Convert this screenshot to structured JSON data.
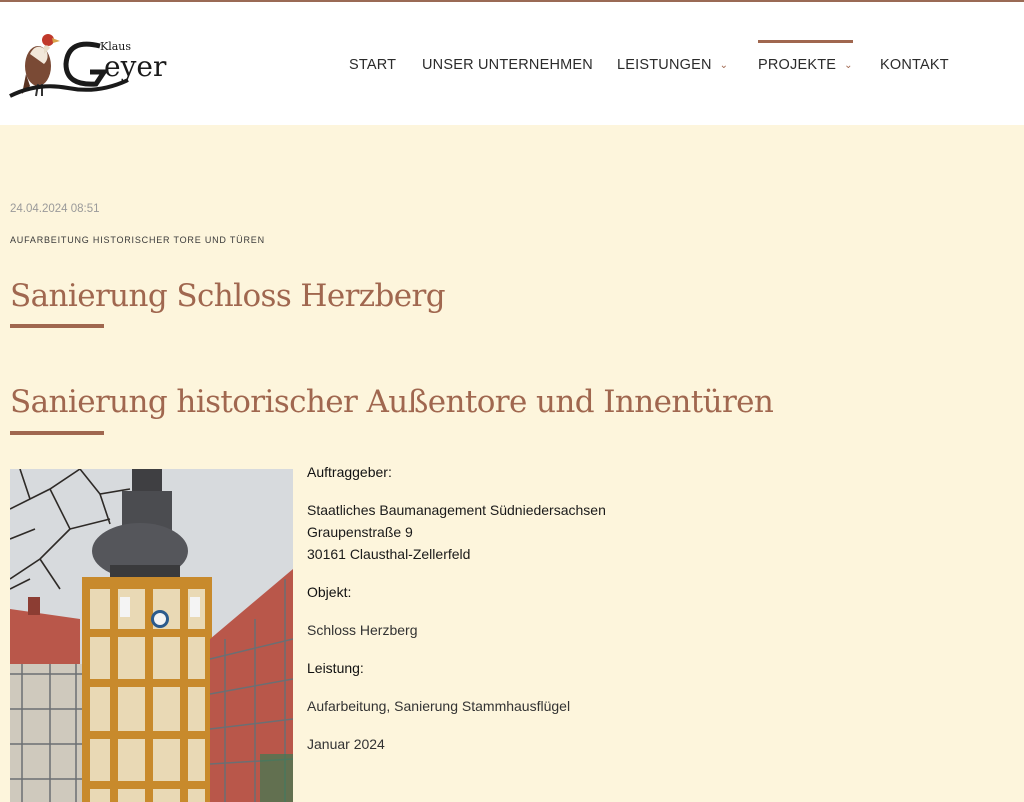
{
  "logo": {
    "small": "Klaus",
    "big": "Geyer"
  },
  "nav": {
    "items": [
      {
        "label": "START"
      },
      {
        "label": "UNSER UNTERNEHMEN"
      },
      {
        "label": "LEISTUNGEN"
      },
      {
        "label": "PROJEKTE"
      },
      {
        "label": "KONTAKT"
      }
    ],
    "active": "PROJEKTE"
  },
  "post": {
    "date": "24.04.2024 08:51",
    "category": "AUFARBEITUNG HISTORISCHER TORE UND TÜREN",
    "title": "Sanierung Schloss Herzberg",
    "subtitle": "Sanierung historischer Außentore und Innentüren"
  },
  "details": {
    "client_label": "Auftraggeber:",
    "client_line1": "Staatliches Baumanagement Südniedersachsen",
    "client_line2": "Graupenstraße 9",
    "client_line3": "30161 Clausthal-Zellerfeld",
    "object_label": "Objekt:",
    "object_value": "Schloss Herzberg",
    "service_label": "Leistung:",
    "service_value": "Aufarbeitung, Sanierung Stammhausflügel",
    "date_value": "Januar 2024"
  },
  "colors": {
    "accent": "#a0674f",
    "background": "#fdf5dc",
    "header": "#ffffff"
  }
}
